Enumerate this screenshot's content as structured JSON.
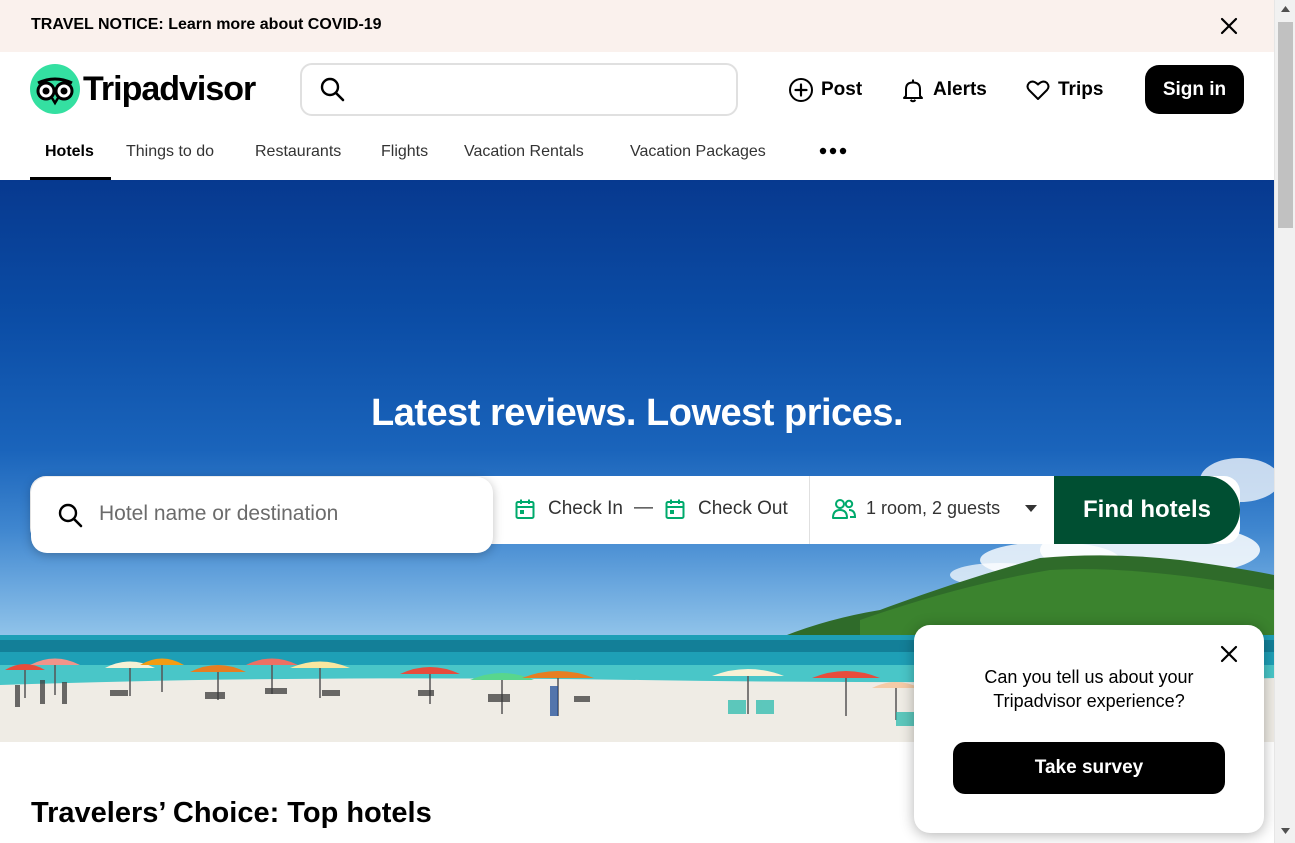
{
  "notice": {
    "text": "TRAVEL NOTICE: Learn more about COVID-19"
  },
  "header": {
    "logo_text": "Tripadvisor",
    "search_placeholder": "",
    "post_label": "Post",
    "alerts_label": "Alerts",
    "trips_label": "Trips",
    "signin_label": "Sign in"
  },
  "nav": {
    "items": [
      {
        "label": "Hotels",
        "active": true
      },
      {
        "label": "Things to do"
      },
      {
        "label": "Restaurants"
      },
      {
        "label": "Flights"
      },
      {
        "label": "Vacation Rentals"
      },
      {
        "label": "Vacation Packages"
      }
    ]
  },
  "hero": {
    "title": "Latest reviews. Lowest prices.",
    "search": {
      "placeholder": "Hotel name or destination",
      "check_in": "Check In",
      "separator": "—",
      "check_out": "Check Out",
      "guests": "1 room, 2 guests",
      "find_label": "Find hotels"
    }
  },
  "section": {
    "title": "Travelers’ Choice: Top hotels"
  },
  "survey": {
    "text": "Can you tell us about your Tripadvisor experience?",
    "button_label": "Take survey"
  },
  "colors": {
    "brand_green": "#34e0a1",
    "find_button": "#004f32",
    "notice_bg": "#faf1ed",
    "calendar_icon": "#00aa6c"
  },
  "icons": {
    "notice_close": "close-icon",
    "top_search": "search-icon",
    "post": "plus-circle-icon",
    "alerts": "bell-icon",
    "trips": "heart-icon",
    "nav_more": "more-dots-icon",
    "calendar": "calendar-icon",
    "guests": "people-icon",
    "caret": "caret-down-icon"
  }
}
